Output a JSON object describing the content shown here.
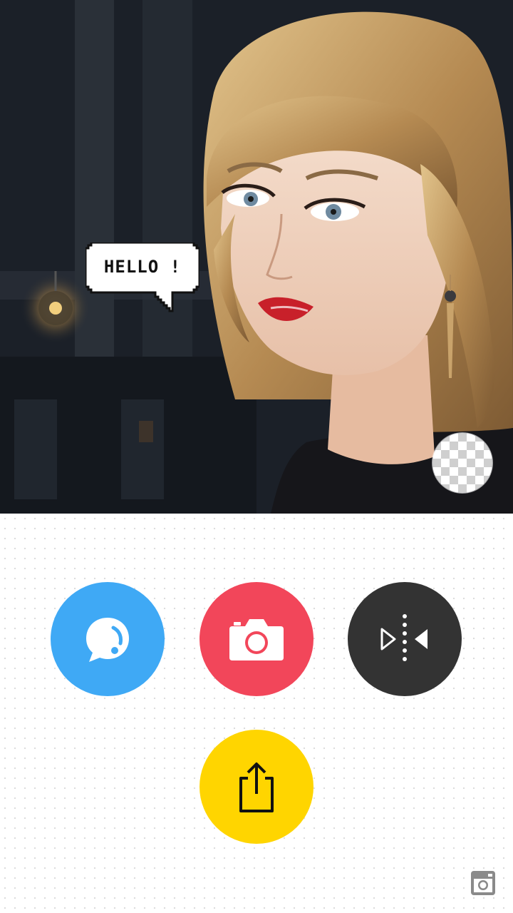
{
  "editor": {
    "photo_name": "portrait-photo",
    "sticker_text": "HELLO !"
  },
  "controls": {
    "sticker_button_color": "#3FA9F5",
    "camera_button_color": "#F2465A",
    "mirror_button_color": "#333333",
    "share_button_color": "#FFD500",
    "icons": [
      "speech-bubble-icon",
      "camera-icon",
      "mirror-flip-icon",
      "share-icon",
      "instagram-icon",
      "transparency-icon"
    ]
  }
}
